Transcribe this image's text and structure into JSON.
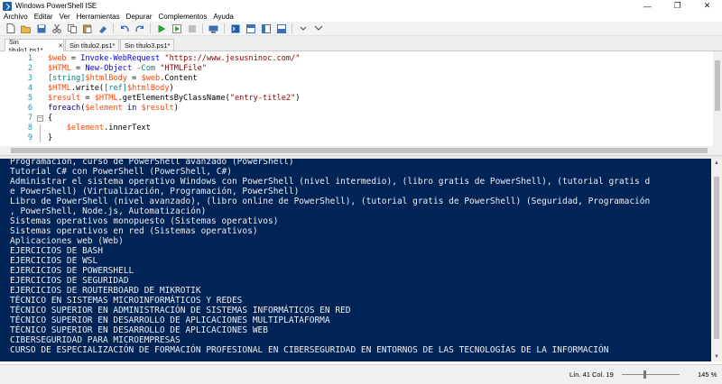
{
  "window": {
    "title": "Windows PowerShell ISE",
    "minimize": "—",
    "maximize": "❐",
    "close": "✕"
  },
  "menu": [
    "Archivo",
    "Editar",
    "Ver",
    "Herramientas",
    "Depurar",
    "Complementos",
    "Ayuda"
  ],
  "toolbar": {
    "icons": [
      "new-file-icon",
      "open-icon",
      "save-icon",
      "cut-icon",
      "copy-icon",
      "paste-icon",
      "clear-icon",
      "undo-icon",
      "redo-icon",
      "run-icon",
      "run-selection-icon",
      "stop-icon",
      "remote-icon",
      "console-icon",
      "layout-icon",
      "layout2-icon",
      "layout3-icon",
      "expand-icon",
      "show-commands-icon"
    ]
  },
  "tabs": [
    {
      "label": "Sin título1.ps1*",
      "active": true
    },
    {
      "label": "Sin título2.ps1*",
      "active": false
    },
    {
      "label": "Sin título3.ps1*",
      "active": false
    }
  ],
  "editor": {
    "lines": [
      {
        "n": "1",
        "tokens": [
          [
            "v",
            "$web"
          ],
          [
            "p",
            " = "
          ],
          [
            "t",
            "Invoke-WebRequest"
          ],
          [
            "p",
            " "
          ],
          [
            "s",
            "\"https://www.jesusninoc.com/\""
          ]
        ]
      },
      {
        "n": "2",
        "tokens": [
          [
            "v",
            "$HTML"
          ],
          [
            "p",
            " = "
          ],
          [
            "t",
            "New-Object"
          ],
          [
            "p",
            " "
          ],
          [
            "ty",
            "-Com"
          ],
          [
            "p",
            " "
          ],
          [
            "s",
            "\"HTMLFile\""
          ]
        ]
      },
      {
        "n": "3",
        "tokens": [
          [
            "ty",
            "[string]"
          ],
          [
            "v",
            "$htmlBody"
          ],
          [
            "p",
            " = "
          ],
          [
            "v",
            "$web"
          ],
          [
            "p",
            ".Content"
          ]
        ]
      },
      {
        "n": "4",
        "tokens": [
          [
            "v",
            "$HTML"
          ],
          [
            "p",
            ".write("
          ],
          [
            "ty",
            "[ref]"
          ],
          [
            "v",
            "$htmlBody"
          ],
          [
            "p",
            ")"
          ]
        ]
      },
      {
        "n": "5",
        "tokens": [
          [
            "v",
            "$result"
          ],
          [
            "p",
            " = "
          ],
          [
            "v",
            "$HTML"
          ],
          [
            "p",
            ".getElementsByClassName("
          ],
          [
            "s",
            "\"entry-title2\""
          ],
          [
            "p",
            ")"
          ]
        ]
      },
      {
        "n": "6",
        "tokens": [
          [
            "k",
            "foreach"
          ],
          [
            "p",
            "("
          ],
          [
            "v",
            "$element"
          ],
          [
            "p",
            " "
          ],
          [
            "k",
            "in"
          ],
          [
            "p",
            " "
          ],
          [
            "v",
            "$result"
          ],
          [
            "p",
            ")"
          ]
        ]
      },
      {
        "n": "7",
        "tokens": [
          [
            "p",
            "{"
          ]
        ]
      },
      {
        "n": "8",
        "tokens": [
          [
            "p",
            "    "
          ],
          [
            "v",
            "$element"
          ],
          [
            "p",
            ".innerText"
          ]
        ]
      },
      {
        "n": "9",
        "tokens": [
          [
            "p",
            "}"
          ]
        ]
      }
    ]
  },
  "console": {
    "lines": [
      "Programación, curso de PowerShell avanzado (PowerShell)",
      "Tutorial C# con PowerShell (PowerShell, C#)",
      "Administrar el sistema operativo Windows con PowerShell (nivel intermedio), (libro gratis de PowerShell), (tutorial gratis d",
      "e PowerShell) (Virtualización, Programación, PowerShell)",
      "Libro de PowerShell (nivel avanzado), (libro online de PowerShell), (tutorial gratis de PowerShell) (Seguridad, Programación",
      ", PowerShell, Node.js, Automatización)",
      "Sistemas operativos monopuesto (Sistemas operativos)",
      "Sistemas operativos en red (Sistemas operativos)",
      "Aplicaciones web (Web)",
      "EJERCICIOS DE BASH",
      "EJERCICIOS DE WSL",
      "EJERCICIOS DE POWERSHELL",
      "EJERCICIOS DE SEGURIDAD",
      "EJERCICIOS DE ROUTERBOARD DE MIKROTIK",
      "TÉCNICO EN SISTEMAS MICROINFORMÁTICOS Y REDES",
      "TÉCNICO SUPERIOR EN ADMINISTRACIÓN DE SISTEMAS INFORMÁTICOS EN RED",
      "TÉCNICO SUPERIOR EN DESARROLLO DE APLICACIONES MULTIPLATAFORMA",
      "TÉCNICO SUPERIOR EN DESARROLLO DE APLICACIONES WEB",
      "CIBERSEGURIDAD PARA MICROEMPRESAS",
      "CURSO DE ESPECIALIZACIÓN DE FORMACIÓN PROFESIONAL EN CIBERSEGURIDAD EN ENTORNOS DE LAS TECNOLOGÍAS DE LA INFORMACIÓN"
    ]
  },
  "status": {
    "position": "Lín. 41  Col. 19",
    "zoom": "145 %"
  },
  "colors": {
    "console_bg": "#012456",
    "console_fg": "#eeedf0",
    "variable": "#ff4500",
    "command": "#0000ff",
    "string": "#8b0000",
    "type": "#008080",
    "keyword": "#00008b"
  }
}
